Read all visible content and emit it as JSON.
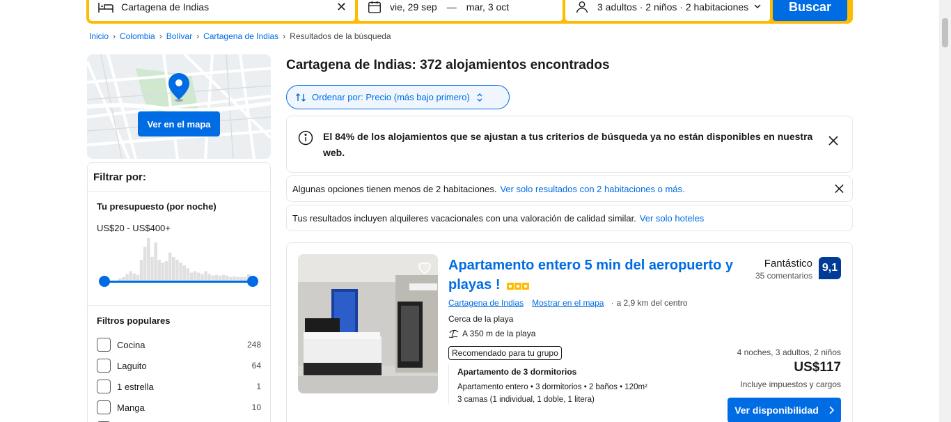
{
  "search": {
    "destination": "Cartagena de Indias",
    "checkin": "vie, 29 sep",
    "dash": "—",
    "checkout": "mar, 3 oct",
    "guests": "3 adultos · 2 niños · 2 habitaciones",
    "button": "Buscar"
  },
  "breadcrumb": [
    "Inicio",
    "Colombia",
    "Bolívar",
    "Cartagena de Indias",
    "Resultados de la búsqueda"
  ],
  "map": {
    "button": "Ver en el mapa"
  },
  "filters": {
    "title": "Filtrar por:",
    "budget_title": "Tu presupuesto (por noche)",
    "budget_range": "US$20 - US$400+",
    "histogram": [
      4,
      6,
      10,
      14,
      11,
      9,
      30,
      48,
      60,
      34,
      54,
      30,
      26,
      28,
      40,
      34,
      30,
      26,
      22,
      18,
      12,
      14,
      12,
      10,
      14,
      10,
      8,
      9,
      8,
      9,
      8,
      6,
      7,
      6,
      6,
      6,
      10
    ],
    "popular_title": "Filtros populares",
    "popular": [
      {
        "label": "Cocina",
        "count": "248"
      },
      {
        "label": "Laguito",
        "count": "64"
      },
      {
        "label": "1 estrella",
        "count": "1"
      },
      {
        "label": "Manga",
        "count": "10"
      }
    ]
  },
  "results": {
    "heading": "Cartagena de Indias: 372 alojamientos encontrados",
    "sort_label": "Ordenar por: Precio (más bajo primero)",
    "notice": "El 84% de los alojamientos que se ajustan a tus criterios de búsqueda ya no están disponibles en nuestra web.",
    "info1_text": "Algunas opciones tienen menos de 2 habitaciones.",
    "info1_link": "Ver solo resultados con 2 habitaciones o más.",
    "info2_text": "Tus resultados incluyen alquileres vacacionales con una valoración de calidad similar.",
    "info2_link": "Ver solo hoteles"
  },
  "property": {
    "title": "Apartamento entero 5 min del aeropuerto y playas !",
    "stars": 3,
    "rating_label": "Fantástico",
    "reviews": "35 comentarios",
    "score": "9,1",
    "city_link": "Cartagena de Indias",
    "map_link": "Mostrar en el mapa",
    "distance": "a 2,9 km del centro",
    "near": "Cerca de la playa",
    "beach": "A 350 m de la playa",
    "badge": "Recomendado para tu grupo",
    "unit_title": "Apartamento de 3 dormitorios",
    "unit_desc": "Apartamento entero • 3 dormitorios • 2 baños • 120m²",
    "unit_beds": "3 camas (1 individual, 1 doble, 1 litera)",
    "price_meta": "4 noches, 3 adultos, 2 niños",
    "price": "US$117",
    "taxes": "Incluye impuestos y cargos",
    "button": "Ver disponibilidad"
  },
  "colors": {
    "primary": "#006ce4",
    "accent": "#febb02",
    "score_bg": "#003b95"
  }
}
